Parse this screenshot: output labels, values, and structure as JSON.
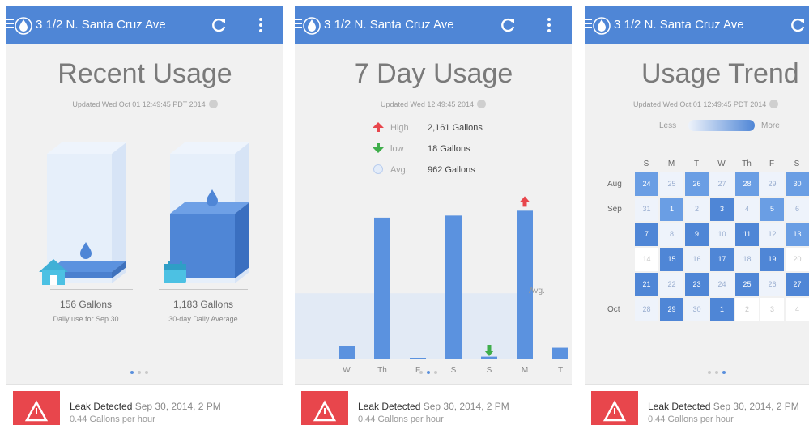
{
  "app": {
    "address": "3 1/2 N. Santa Cruz Ave"
  },
  "colors": {
    "appbar": "#4f86d6",
    "accent_blue": "#4f86d6",
    "leak_red": "#e8464c",
    "high_red": "#e8464c",
    "low_green": "#3fae4b"
  },
  "screens": [
    {
      "title": "Recent Usage",
      "updated": "Updated Wed Oct 01 12:49:45 PDT 2014",
      "left_cube": {
        "value": "156 Gallons",
        "subtitle": "Daily use for Sep 30",
        "icon": "house-icon"
      },
      "right_cube": {
        "value": "1,183 Gallons",
        "subtitle": "30-day Daily Average",
        "icon": "calendar-icon"
      },
      "pager_active": 0,
      "leak": {
        "title": "Leak Detected",
        "date": "Sep 30, 2014, 2 PM",
        "rate": "0.44 Gallons per hour"
      }
    },
    {
      "title": "7 Day Usage",
      "updated": "Updated Wed 12:49:45 2014",
      "stats": [
        {
          "icon": "arrow-up-icon",
          "label": "High",
          "value": "2,161 Gallons"
        },
        {
          "icon": "arrow-down-icon",
          "label": "low",
          "value": "18 Gallons"
        },
        {
          "icon": "average-circle-icon",
          "label": "Avg.",
          "value": "962 Gallons"
        }
      ],
      "avg_label": "Avg.",
      "pager_active": 1,
      "leak": {
        "title": "Leak Detected",
        "date": "Sep 30, 2014, 2 PM",
        "rate": "0.44 Gallons per hour"
      }
    },
    {
      "title": "Usage Trend",
      "updated": "Updated Wed Oct 01 12:49:45 PDT 2014",
      "legend": {
        "less": "Less",
        "more": "More"
      },
      "weekdays": [
        "S",
        "M",
        "T",
        "W",
        "Th",
        "F",
        "S"
      ],
      "month_labels": [
        {
          "label": "Aug",
          "row": 0
        },
        {
          "label": "Sep",
          "row": 1
        },
        {
          "label": "Oct",
          "row": 5
        }
      ],
      "calendar_rows": [
        [
          {
            "d": "24",
            "lvl": 2
          },
          {
            "d": "25",
            "lvl": 1
          },
          {
            "d": "26",
            "lvl": 2
          },
          {
            "d": "27",
            "lvl": 1
          },
          {
            "d": "28",
            "lvl": 2
          },
          {
            "d": "29",
            "lvl": 1
          },
          {
            "d": "30",
            "lvl": 2
          }
        ],
        [
          {
            "d": "31",
            "lvl": 1
          },
          {
            "d": "1",
            "lvl": 2
          },
          {
            "d": "2",
            "lvl": 1
          },
          {
            "d": "3",
            "lvl": 3
          },
          {
            "d": "4",
            "lvl": 1
          },
          {
            "d": "5",
            "lvl": 2
          },
          {
            "d": "6",
            "lvl": 1
          }
        ],
        [
          {
            "d": "7",
            "lvl": 3
          },
          {
            "d": "8",
            "lvl": 1
          },
          {
            "d": "9",
            "lvl": 3
          },
          {
            "d": "10",
            "lvl": 1
          },
          {
            "d": "11",
            "lvl": 3
          },
          {
            "d": "12",
            "lvl": 1
          },
          {
            "d": "13",
            "lvl": 2
          }
        ],
        [
          {
            "d": "14",
            "lvl": 0
          },
          {
            "d": "15",
            "lvl": 3
          },
          {
            "d": "16",
            "lvl": 1
          },
          {
            "d": "17",
            "lvl": 3
          },
          {
            "d": "18",
            "lvl": 1
          },
          {
            "d": "19",
            "lvl": 3
          },
          {
            "d": "20",
            "lvl": 0
          }
        ],
        [
          {
            "d": "21",
            "lvl": 3
          },
          {
            "d": "22",
            "lvl": 1
          },
          {
            "d": "23",
            "lvl": 3
          },
          {
            "d": "24",
            "lvl": 1
          },
          {
            "d": "25",
            "lvl": 3
          },
          {
            "d": "26",
            "lvl": 1
          },
          {
            "d": "27",
            "lvl": 3
          }
        ],
        [
          {
            "d": "28",
            "lvl": 1
          },
          {
            "d": "29",
            "lvl": 3
          },
          {
            "d": "30",
            "lvl": 1
          },
          {
            "d": "1",
            "lvl": 3
          },
          {
            "d": "2",
            "lvl": 0
          },
          {
            "d": "3",
            "lvl": 0
          },
          {
            "d": "4",
            "lvl": 0
          }
        ]
      ],
      "pager_active": 2,
      "leak": {
        "title": "Leak Detected",
        "date": "Sep 30, 2014, 2 PM",
        "rate": "0.44 Gallons per hour"
      }
    }
  ],
  "chart_data": {
    "type": "bar",
    "categories": [
      "W",
      "Th",
      "F",
      "S",
      "S",
      "M",
      "T"
    ],
    "values": [
      200,
      2060,
      18,
      2090,
      40,
      2161,
      170
    ],
    "average": 962,
    "high_index": 5,
    "low_index": 2,
    "ylim": [
      0,
      2400
    ]
  }
}
